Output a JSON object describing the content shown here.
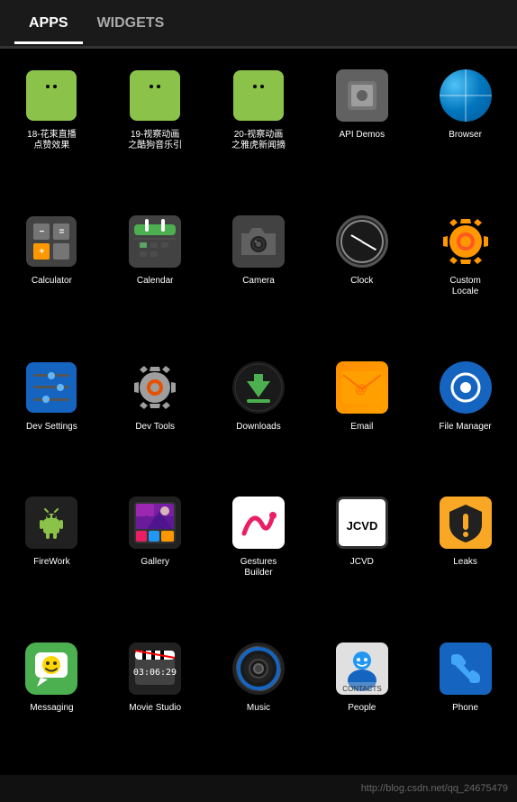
{
  "header": {
    "tab_apps": "APPS",
    "tab_widgets": "WIDGETS"
  },
  "apps": [
    {
      "id": "app-18",
      "label": "18-花束直播\n点赞效果",
      "icon_type": "android-green"
    },
    {
      "id": "app-19",
      "label": "19-视察动画\n之酷狗音乐引",
      "icon_type": "android-green"
    },
    {
      "id": "app-20",
      "label": "20-视察动画\n之雅虎新闻摘",
      "icon_type": "android-green"
    },
    {
      "id": "api-demos",
      "label": "API Demos",
      "icon_type": "api"
    },
    {
      "id": "browser",
      "label": "Browser",
      "icon_type": "browser"
    },
    {
      "id": "calculator",
      "label": "Calculator",
      "icon_type": "calculator"
    },
    {
      "id": "calendar",
      "label": "Calendar",
      "icon_type": "calendar"
    },
    {
      "id": "camera",
      "label": "Camera",
      "icon_type": "camera"
    },
    {
      "id": "clock",
      "label": "Clock",
      "icon_type": "clock"
    },
    {
      "id": "custom-locale",
      "label": "Custom\nLocale",
      "icon_type": "gear-orange"
    },
    {
      "id": "dev-settings",
      "label": "Dev Settings",
      "icon_type": "dev-settings"
    },
    {
      "id": "dev-tools",
      "label": "Dev Tools",
      "icon_type": "gear-white"
    },
    {
      "id": "downloads",
      "label": "Downloads",
      "icon_type": "downloads"
    },
    {
      "id": "email",
      "label": "Email",
      "icon_type": "email"
    },
    {
      "id": "file-manager",
      "label": "File Manager",
      "icon_type": "file-manager"
    },
    {
      "id": "firework",
      "label": "FireWork",
      "icon_type": "firework"
    },
    {
      "id": "gallery",
      "label": "Gallery",
      "icon_type": "gallery"
    },
    {
      "id": "gestures-builder",
      "label": "Gestures\nBuilder",
      "icon_type": "gestures"
    },
    {
      "id": "jcvd",
      "label": "JCVD",
      "icon_type": "jcvd"
    },
    {
      "id": "leaks",
      "label": "Leaks",
      "icon_type": "leaks"
    },
    {
      "id": "messaging",
      "label": "Messaging",
      "icon_type": "messaging"
    },
    {
      "id": "movie-studio",
      "label": "Movie Studio",
      "icon_type": "movie"
    },
    {
      "id": "music",
      "label": "Music",
      "icon_type": "music"
    },
    {
      "id": "people",
      "label": "People",
      "icon_type": "people"
    },
    {
      "id": "phone",
      "label": "Phone",
      "icon_type": "phone"
    }
  ],
  "footer": {
    "url": "http://blog.csdn.net/qq_24675479"
  }
}
